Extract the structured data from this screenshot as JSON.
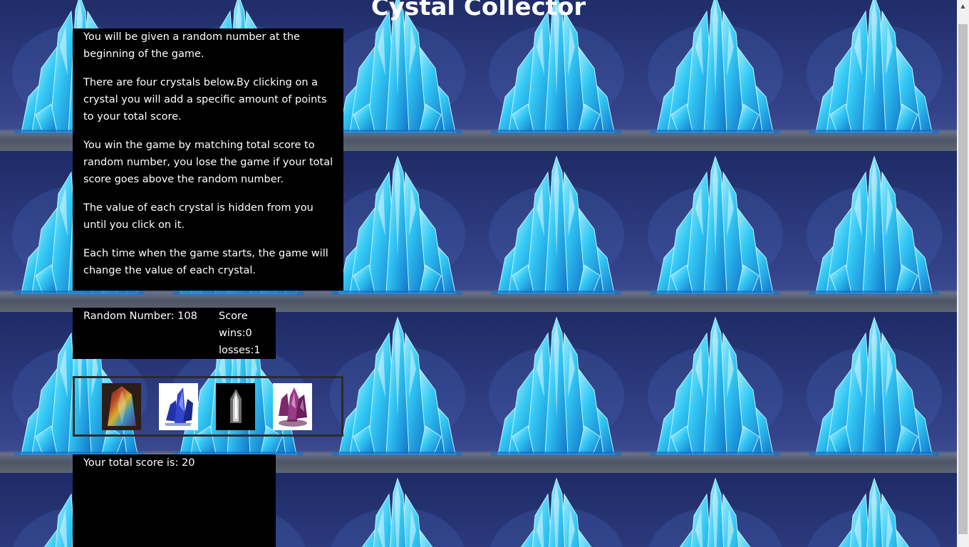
{
  "page": {
    "title": "Cystal Collector"
  },
  "instructions": {
    "paragraphs": [
      "You will be given a random number at the beginning of the game.",
      "There are four crystals below.By clicking on a crystal you will add a specific amount of points to your total score.",
      "You win the game by matching total score to random number, you lose the game if your total score goes above the random number.",
      "The value of each crystal is hidden from you until you click on it.",
      "Each time when the game starts, the game will change the value of each crystal."
    ]
  },
  "stats": {
    "random_number": "Random Number: 108",
    "score_label": "Score",
    "wins": "wins:0",
    "losses": "losses:1"
  },
  "crystals": [
    {
      "icon": "rainbow-crystal-icon"
    },
    {
      "icon": "blue-crystal-icon"
    },
    {
      "icon": "clear-quartz-crystal-icon"
    },
    {
      "icon": "purple-crystal-icon"
    }
  ],
  "total": {
    "text": "Your total score is: 20"
  },
  "colors": {
    "background": "#2a3a7a",
    "panel": "#000000",
    "text": "#ffffff",
    "crystal": "#29c4f0"
  }
}
